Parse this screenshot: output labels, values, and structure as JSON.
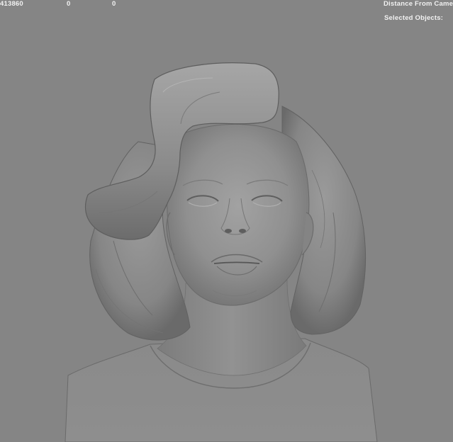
{
  "hud": {
    "poly_count": "413860",
    "counter_a": "0",
    "counter_b": "0",
    "distance_label": "Distance From Came",
    "selected_label": "Selected Objects:"
  },
  "colors": {
    "background": "#858585",
    "mesh_mid": "#8e8e8e",
    "mesh_shadow": "#5e5e5e",
    "mesh_highlight": "#b0b0b0",
    "hud_text": "#f2f2f2"
  },
  "scene": {
    "object": "sculpted-head-bust"
  }
}
